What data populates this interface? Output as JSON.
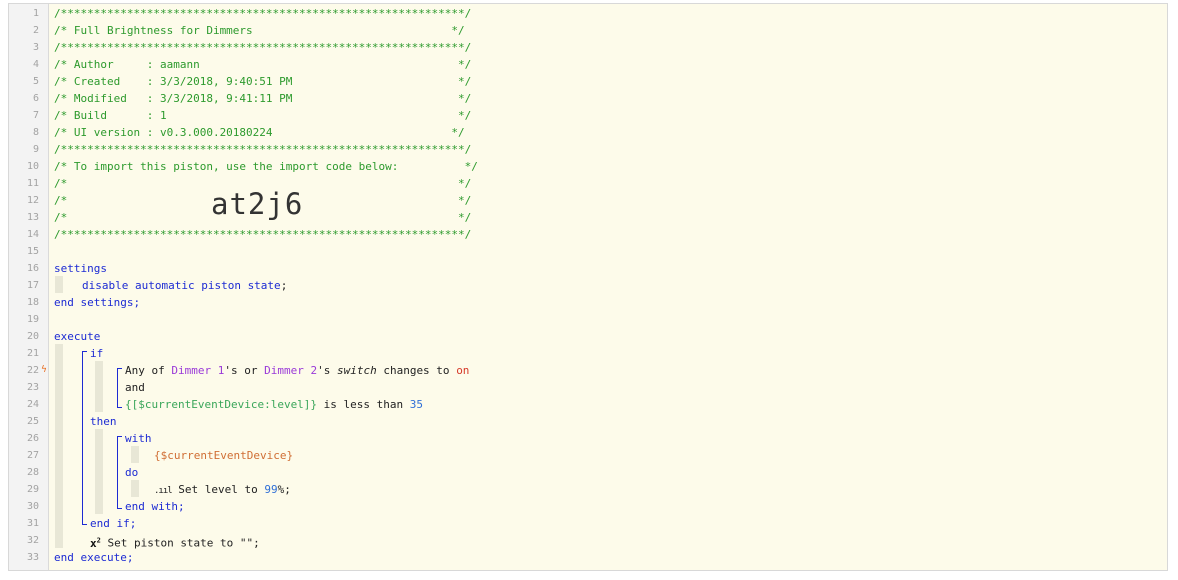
{
  "gutter": {
    "line_numbers": [
      "1",
      "2",
      "3",
      "4",
      "5",
      "6",
      "7",
      "8",
      "9",
      "10",
      "11",
      "12",
      "13",
      "14",
      "15",
      "16",
      "17",
      "18",
      "19",
      "20",
      "21",
      "22",
      "23",
      "24",
      "25",
      "26",
      "27",
      "28",
      "29",
      "30",
      "31",
      "32",
      "33"
    ],
    "bolt_glyph": "ϟ"
  },
  "header": {
    "border": "/*************************************************************/",
    "title_line": "/* Full Brightness for Dimmers                              */",
    "author_line": "/* Author     : aamann                                       */",
    "created_line": "/* Created    : 3/3/2018, 9:40:51 PM                         */",
    "modified_line": "/* Modified   : 3/3/2018, 9:41:11 PM                         */",
    "build_line": "/* Build      : 1                                            */",
    "ui_version_line": "/* UI version : v0.3.000.20180224                           */",
    "import_line": "/* To import this piston, use the import code below:          */",
    "empty_line": "/*                                                           */",
    "import_code": "at2j6"
  },
  "code": {
    "settings_kw": "settings",
    "disable_kw": "disable automatic piston state",
    "semicolon": ";",
    "end_settings": "end settings;",
    "execute_kw": "execute",
    "if_kw": "if",
    "cond_any_of": "Any of ",
    "cond_dimmer1": "Dimmer 1",
    "cond_s_or": "'s or ",
    "cond_dimmer2": "Dimmer 2",
    "cond_s": "'s ",
    "cond_switch": "switch",
    "cond_changes_to": " changes to ",
    "cond_on": "on",
    "and_kw": "and",
    "expr": "{[$currentEventDevice:level]}",
    "is_less_than": " is less than ",
    "value_35": "35",
    "then_kw": "then",
    "with_kw": "with",
    "with_device": "{$currentEventDevice}",
    "do_kw": "do",
    "set_level_icon": ".ııl",
    "set_level_text": " Set level to ",
    "value_99": "99",
    "percent_semi": "%;",
    "end_with": "end with;",
    "end_if": "end if;",
    "x2_icon": "x",
    "x2_sup": "2",
    "set_state_text": " Set piston state to \"\";",
    "end_execute": "end execute;"
  }
}
